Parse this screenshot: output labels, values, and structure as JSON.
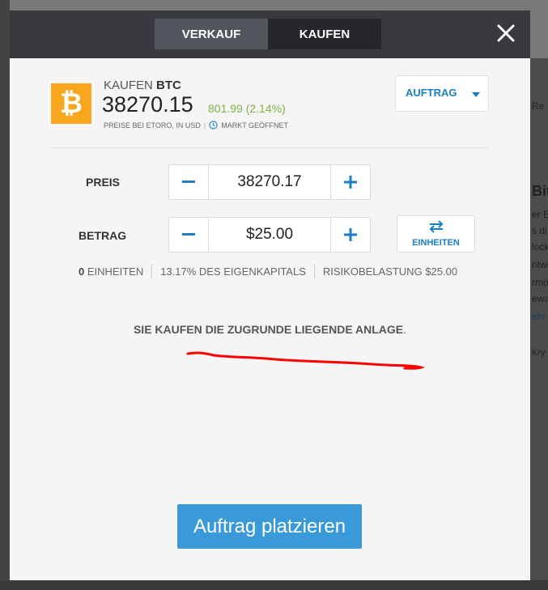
{
  "header": {
    "tabs": [
      {
        "label": "VERKAUF",
        "active": true
      },
      {
        "label": "KAUFEN",
        "active": false
      }
    ]
  },
  "asset": {
    "action": "KAUFEN",
    "symbol": "BTC",
    "price": "38270.15",
    "change": "801.99 (2.14%)",
    "price_source": "PREISE BEI ETORO, IN USD",
    "separator": "|",
    "market_status": "MARKT GEÖFFNET",
    "logo_color": "#f7a61d",
    "change_color": "#7cb342"
  },
  "order_type": {
    "label": "AUFTRAG"
  },
  "price_row": {
    "label": "PREIS",
    "value": "38270.17"
  },
  "amount_row": {
    "label": "BETRAG",
    "value": "$25.00"
  },
  "units_button": {
    "label": "EINHEITEN"
  },
  "info": {
    "units_count": "0",
    "units_label": "EINHEITEN",
    "equity": "13.17% DES EIGENKAPITALS",
    "risk_label": "RISIKOBELASTUNG",
    "risk_value": "$25.00"
  },
  "notice": {
    "text": "SIE KAUFEN DIE ZUGRUNDE LIEGENDE ANLAGE",
    "dot": "."
  },
  "place_button": {
    "label": "Auftrag platzieren"
  },
  "background_right": {
    "lines": [
      "Re",
      "Bit",
      "er E",
      "s di",
      "lock",
      "ntwi",
      "rmö",
      "ewa",
      "ehr",
      "Kry"
    ]
  },
  "colors": {
    "accent": "#1b7fc3",
    "primary_button": "#3a9ad9",
    "header": "#383a40",
    "annotation": "#ff0000"
  }
}
